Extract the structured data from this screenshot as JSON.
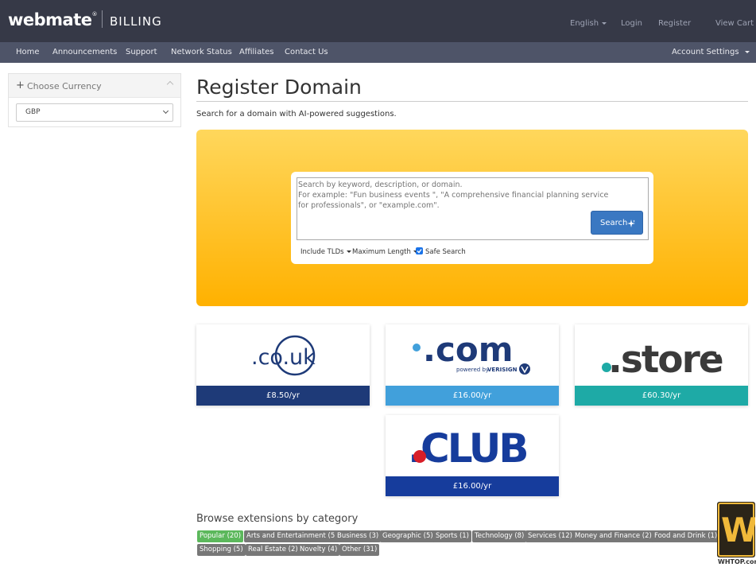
{
  "brand": {
    "logo": "webmate",
    "logo_mark": "®",
    "section": "BILLING"
  },
  "top_links": {
    "language": "English",
    "login": "Login",
    "register": "Register",
    "cart": "View Cart"
  },
  "nav": {
    "items": [
      "Home",
      "Announcements",
      "Support",
      "Network Status",
      "Affiliates",
      "Contact Us"
    ],
    "account": "Account Settings"
  },
  "sidebar": {
    "currency_title": "Choose Currency",
    "currency_value": "GBP"
  },
  "main": {
    "title": "Register Domain",
    "subtitle": "Search for a domain with AI-powered suggestions."
  },
  "search": {
    "placeholder_line1": "Search by keyword, description, or domain.",
    "placeholder_line2": "For example: \"Fun business events \", \"A comprehensive financial planning service for professionals\", or \"example.com\".",
    "button": "Search",
    "options": {
      "tlds": "Include TLDs",
      "length": "Maximum Length",
      "safe": "Safe Search"
    },
    "safe_search_checked": true
  },
  "tlds": [
    {
      "name": ".co.uk",
      "price": "£8.50/yr",
      "color": "#1e3a78"
    },
    {
      "name": ".com",
      "tagline": "powered by",
      "partner": "VERISIGN",
      "price": "£16.00/yr",
      "color": "#41a0db"
    },
    {
      "name": ".store",
      "price": "£60.30/yr",
      "color": "#1eaaa6"
    },
    {
      "name": ".CLUB",
      "price": "£16.00/yr",
      "color": "#163c9c"
    }
  ],
  "browse": {
    "title": "Browse extensions by category",
    "categories": [
      "Popular (20)",
      "Arts and Entertainment (5)",
      "Business (3)",
      "Geographic (5)",
      "Sports (1)",
      "Technology (8)",
      "Services (12)",
      "Money and Finance (2)",
      "Food and Drink (1)",
      "Shopping (5)",
      "Real Estate (2)",
      "Novelty (4)",
      "Other (31)"
    ]
  },
  "watermark": {
    "mark": "W",
    "text": "WHTOP.com"
  }
}
